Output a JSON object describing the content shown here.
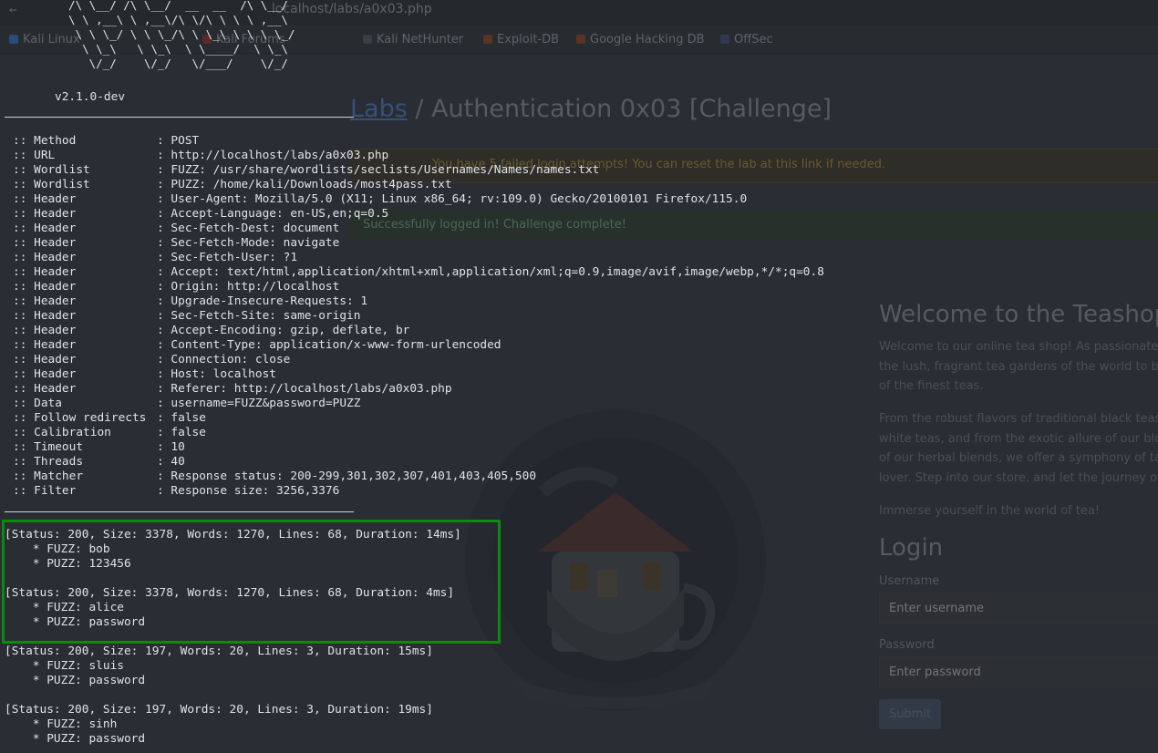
{
  "browser": {
    "url": "localhost/labs/a0x03.php",
    "bookmarks": [
      "Kali Linux",
      "Kali Forums",
      "Kali NetHunter",
      "Exploit-DB",
      "Google Hacking DB",
      "OffSec"
    ],
    "breadcrumb_link": "Labs",
    "title": "/ Authentication 0x03 [Challenge]",
    "warning": "You have 5 failed login attempts! You can reset the lab at this link if needed.",
    "success": "Successfully logged in! Challenge complete!",
    "welcome_heading": "Welcome to the Teashop",
    "welcome_lines": [
      "Welcome to our online tea shop! As passionate p",
      "the lush, fragrant tea gardens of the world to bri",
      "of the finest teas."
    ],
    "para2_lines": [
      "From the robust flavors of traditional black teas t",
      "white teas, and from the exotic allure of our bloo",
      "of our herbal blends, we offer a symphony of tas",
      "lover. Step into our store, and let the journey of"
    ],
    "immerse": "Immerse yourself in the world of tea!",
    "login_heading": "Login",
    "username_label": "Username",
    "username_placeholder": "Enter username",
    "password_label": "Password",
    "password_placeholder": "Enter password",
    "submit_label": "Submit",
    "colors": {
      "accent": "#0b8a12",
      "terminal_text": "#dfe3e8"
    }
  },
  "terminal": {
    "banner": "  /\\ \\__/ /\\ \\__/  __  __  /\\ \\__/\n  \\ \\ ,__\\ \\ ,__\\/\\ \\/\\ \\ \\ \\ ,__\\\n   \\ \\ \\_/ \\ \\ \\_/\\ \\ \\_\\ \\ \\ \\ \\_/\n    \\ \\_\\   \\ \\_\\  \\ \\____/  \\ \\_\\\n     \\/_/    \\/_/   \\/___/    \\/_/",
    "version": "v2.1.0-dev",
    "config": [
      [
        ":: Method",
        ": POST"
      ],
      [
        ":: URL",
        ": http://localhost/labs/a0x03.php"
      ],
      [
        ":: Wordlist",
        ": FUZZ: /usr/share/wordlists/seclists/Usernames/Names/names.txt"
      ],
      [
        ":: Wordlist",
        ": PUZZ: /home/kali/Downloads/most4pass.txt"
      ],
      [
        ":: Header",
        ": User-Agent: Mozilla/5.0 (X11; Linux x86_64; rv:109.0) Gecko/20100101 Firefox/115.0"
      ],
      [
        ":: Header",
        ": Accept-Language: en-US,en;q=0.5"
      ],
      [
        ":: Header",
        ": Sec-Fetch-Dest: document"
      ],
      [
        ":: Header",
        ": Sec-Fetch-Mode: navigate"
      ],
      [
        ":: Header",
        ": Sec-Fetch-User: ?1"
      ],
      [
        ":: Header",
        ": Accept: text/html,application/xhtml+xml,application/xml;q=0.9,image/avif,image/webp,*/*;q=0.8"
      ],
      [
        ":: Header",
        ": Origin: http://localhost"
      ],
      [
        ":: Header",
        ": Upgrade-Insecure-Requests: 1"
      ],
      [
        ":: Header",
        ": Sec-Fetch-Site: same-origin"
      ],
      [
        ":: Header",
        ": Accept-Encoding: gzip, deflate, br"
      ],
      [
        ":: Header",
        ": Content-Type: application/x-www-form-urlencoded"
      ],
      [
        ":: Header",
        ": Connection: close"
      ],
      [
        ":: Header",
        ": Host: localhost"
      ],
      [
        ":: Header",
        ": Referer: http://localhost/labs/a0x03.php"
      ],
      [
        ":: Data",
        ": username=FUZZ&password=PUZZ"
      ],
      [
        ":: Follow redirects",
        ": false"
      ],
      [
        ":: Calibration",
        ": false"
      ],
      [
        ":: Timeout",
        ": 10"
      ],
      [
        ":: Threads",
        ": 40"
      ],
      [
        ":: Matcher",
        ": Response status: 200-299,301,302,307,401,403,405,500"
      ],
      [
        ":: Filter",
        ": Response size: 3256,3376"
      ]
    ],
    "results": [
      {
        "status": "[Status: 200, Size: 3378, Words: 1270, Lines: 68, Duration: 14ms]",
        "fuzz": "    * FUZZ: bob",
        "puzz": "    * PUZZ: 123456"
      },
      {
        "status": "[Status: 200, Size: 3378, Words: 1270, Lines: 68, Duration: 4ms]",
        "fuzz": "    * FUZZ: alice",
        "puzz": "    * PUZZ: password"
      },
      {
        "status": "[Status: 200, Size: 197, Words: 20, Lines: 3, Duration: 15ms]",
        "fuzz": "    * FUZZ: sluis",
        "puzz": "    * PUZZ: password"
      },
      {
        "status": "[Status: 200, Size: 197, Words: 20, Lines: 3, Duration: 19ms]",
        "fuzz": "    * FUZZ: sinh",
        "puzz": "    * PUZZ: password"
      }
    ]
  }
}
